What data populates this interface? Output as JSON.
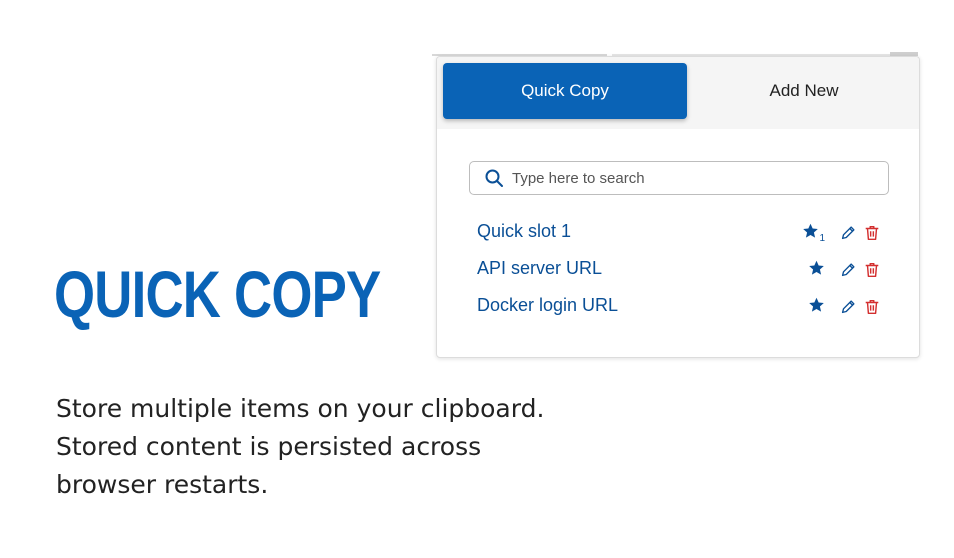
{
  "headline": "QUICK COPY",
  "description": [
    "Store multiple items on your clipboard.",
    "Stored content is persisted across",
    "browser restarts."
  ],
  "popup": {
    "tabs": [
      {
        "label": "Quick Copy",
        "active": true
      },
      {
        "label": "Add New",
        "active": false
      }
    ],
    "search": {
      "placeholder": "Type here to search",
      "value": ""
    },
    "items": [
      {
        "label": "Quick slot 1",
        "star_badge": "1"
      },
      {
        "label": "API server URL",
        "star_badge": ""
      },
      {
        "label": "Docker login URL",
        "star_badge": ""
      }
    ]
  },
  "colors": {
    "brand_blue": "#0a63b6",
    "link_blue": "#0a4f96",
    "delete_red": "#d32f2f"
  },
  "icons": [
    "search-icon",
    "star-icon",
    "pencil-icon",
    "trash-icon"
  ]
}
